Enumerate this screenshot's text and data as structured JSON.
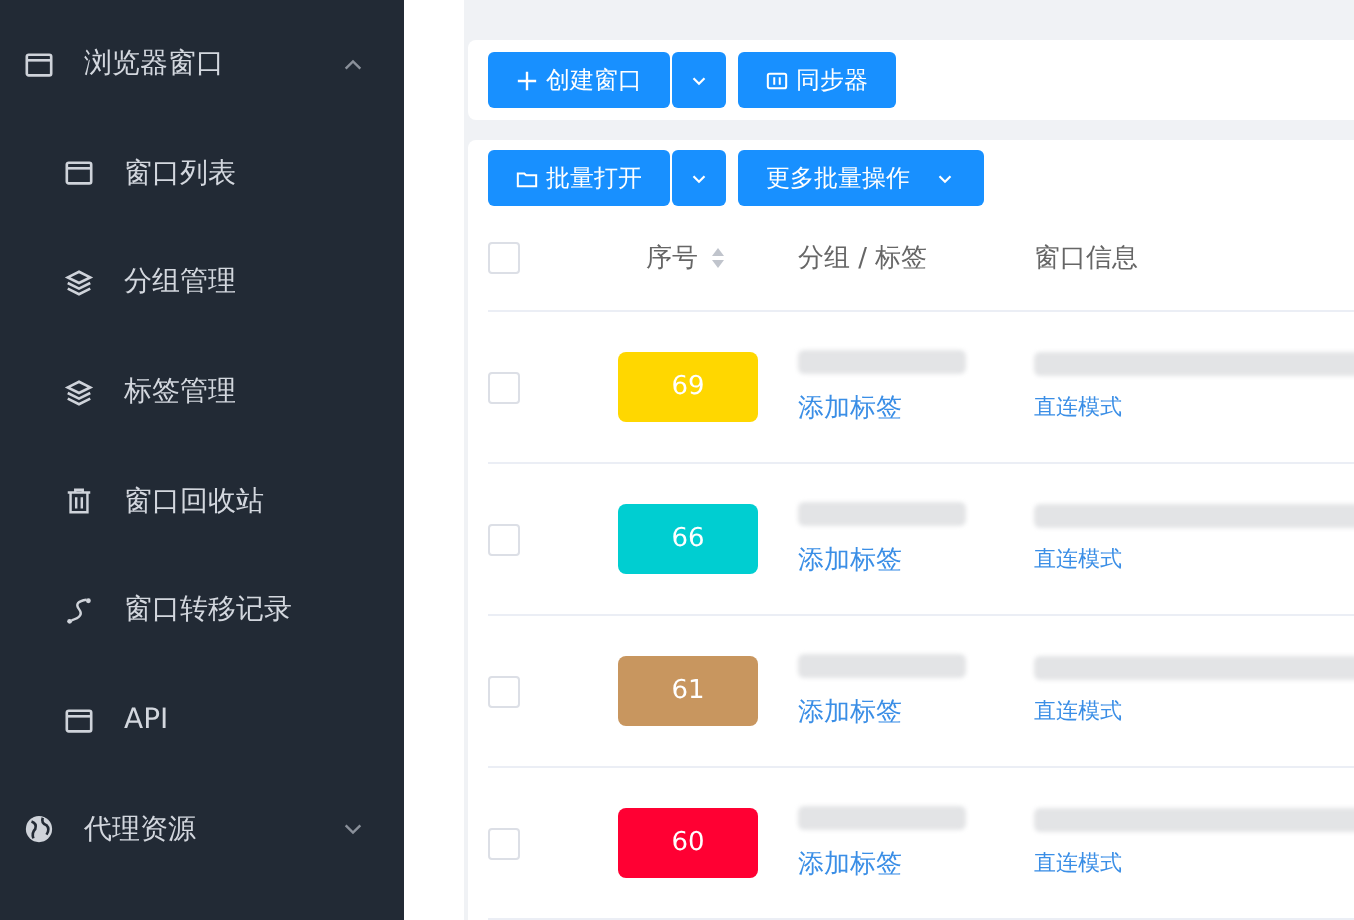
{
  "sidebar": {
    "items": [
      {
        "label": "浏览器窗口",
        "kind": "window",
        "expanded": true,
        "children": [
          {
            "label": "窗口列表",
            "kind": "window"
          },
          {
            "label": "分组管理",
            "kind": "layers"
          },
          {
            "label": "标签管理",
            "kind": "layers"
          },
          {
            "label": "窗口回收站",
            "kind": "trash"
          },
          {
            "label": "窗口转移记录",
            "kind": "route"
          },
          {
            "label": "API",
            "kind": "window"
          }
        ]
      },
      {
        "label": "代理资源",
        "kind": "globe",
        "expanded": false
      }
    ]
  },
  "toolbar": {
    "buttons": [
      {
        "label": "创建窗口",
        "kind": "plus",
        "split": true
      },
      {
        "label": "同步器",
        "kind": "sync",
        "split": false
      }
    ]
  },
  "batch_toolbar": {
    "buttons": [
      {
        "label": "批量打开",
        "kind": "folder",
        "split": true,
        "caret": false
      },
      {
        "label": "更多批量操作",
        "kind": "plain",
        "split": false,
        "caret": true
      }
    ]
  },
  "table": {
    "select_all_checked": false,
    "columns": [
      {
        "label": "序号",
        "sortable": true
      },
      {
        "label": "分组 / 标签",
        "sortable": false
      },
      {
        "label": "窗口信息",
        "sortable": false
      }
    ],
    "rows": [
      {
        "checked": false,
        "number": "69",
        "color": "#ffd700",
        "tag_link": "添加标签",
        "mode": "直连模式"
      },
      {
        "checked": false,
        "number": "66",
        "color": "#00ced1",
        "tag_link": "添加标签",
        "mode": "直连模式"
      },
      {
        "checked": false,
        "number": "61",
        "color": "#c8965f",
        "tag_link": "添加标签",
        "mode": "直连模式"
      },
      {
        "checked": false,
        "number": "60",
        "color": "#ff0033",
        "tag_link": "添加标签",
        "mode": "直连模式"
      }
    ]
  }
}
